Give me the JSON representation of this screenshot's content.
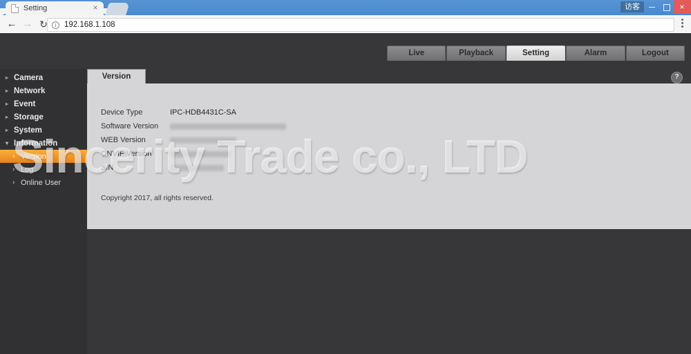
{
  "browser": {
    "tab_title": "Setting",
    "tab_close_glyph": "×",
    "back_glyph": "←",
    "forward_glyph": "→",
    "reload_glyph": "↻",
    "omnibox_url": "192.168.1.108",
    "omnibox_info_glyph": "i",
    "profile_label": "访客",
    "close_glyph": "×"
  },
  "topnav": {
    "tabs": [
      {
        "label": "Live",
        "active": false
      },
      {
        "label": "Playback",
        "active": false
      },
      {
        "label": "Setting",
        "active": true
      },
      {
        "label": "Alarm",
        "active": false
      },
      {
        "label": "Logout",
        "active": false
      }
    ]
  },
  "sidebar": {
    "groups": [
      {
        "label": "Camera",
        "arrow": "▸",
        "expanded": false
      },
      {
        "label": "Network",
        "arrow": "▸",
        "expanded": false
      },
      {
        "label": "Event",
        "arrow": "▸",
        "expanded": false
      },
      {
        "label": "Storage",
        "arrow": "▸",
        "expanded": false
      },
      {
        "label": "System",
        "arrow": "▸",
        "expanded": false
      },
      {
        "label": "Information",
        "arrow": "▾",
        "expanded": true
      }
    ],
    "subitems": [
      {
        "label": "Version",
        "chev": "›",
        "active": true
      },
      {
        "label": "Log",
        "chev": "›",
        "active": false
      },
      {
        "label": "Online User",
        "chev": "›",
        "active": false
      }
    ]
  },
  "content": {
    "tab_label": "Version",
    "help_glyph": "?",
    "rows": [
      {
        "label": "Device Type",
        "value": "IPC-HDB4431C-SA",
        "redacted": false
      },
      {
        "label": "Software Version",
        "value": "",
        "redacted": true,
        "width_class": "r1"
      },
      {
        "label": "WEB Version",
        "value": "",
        "redacted": true,
        "width_class": "r2"
      },
      {
        "label": "ONVIF Version",
        "value": "",
        "redacted": true,
        "width_class": "r3"
      },
      {
        "label": "S/N",
        "value": "",
        "redacted": true,
        "width_class": "r4"
      }
    ],
    "copyright": "Copyright 2017, all rights reserved."
  },
  "watermark": {
    "text": "Sincerity Trade co., LTD"
  },
  "colors": {
    "accent_orange": "#e8821a",
    "app_background": "#37373a",
    "panel_background": "#d5d5d7",
    "sidebar_background": "#313134",
    "browser_blue": "#4f8fd1"
  }
}
